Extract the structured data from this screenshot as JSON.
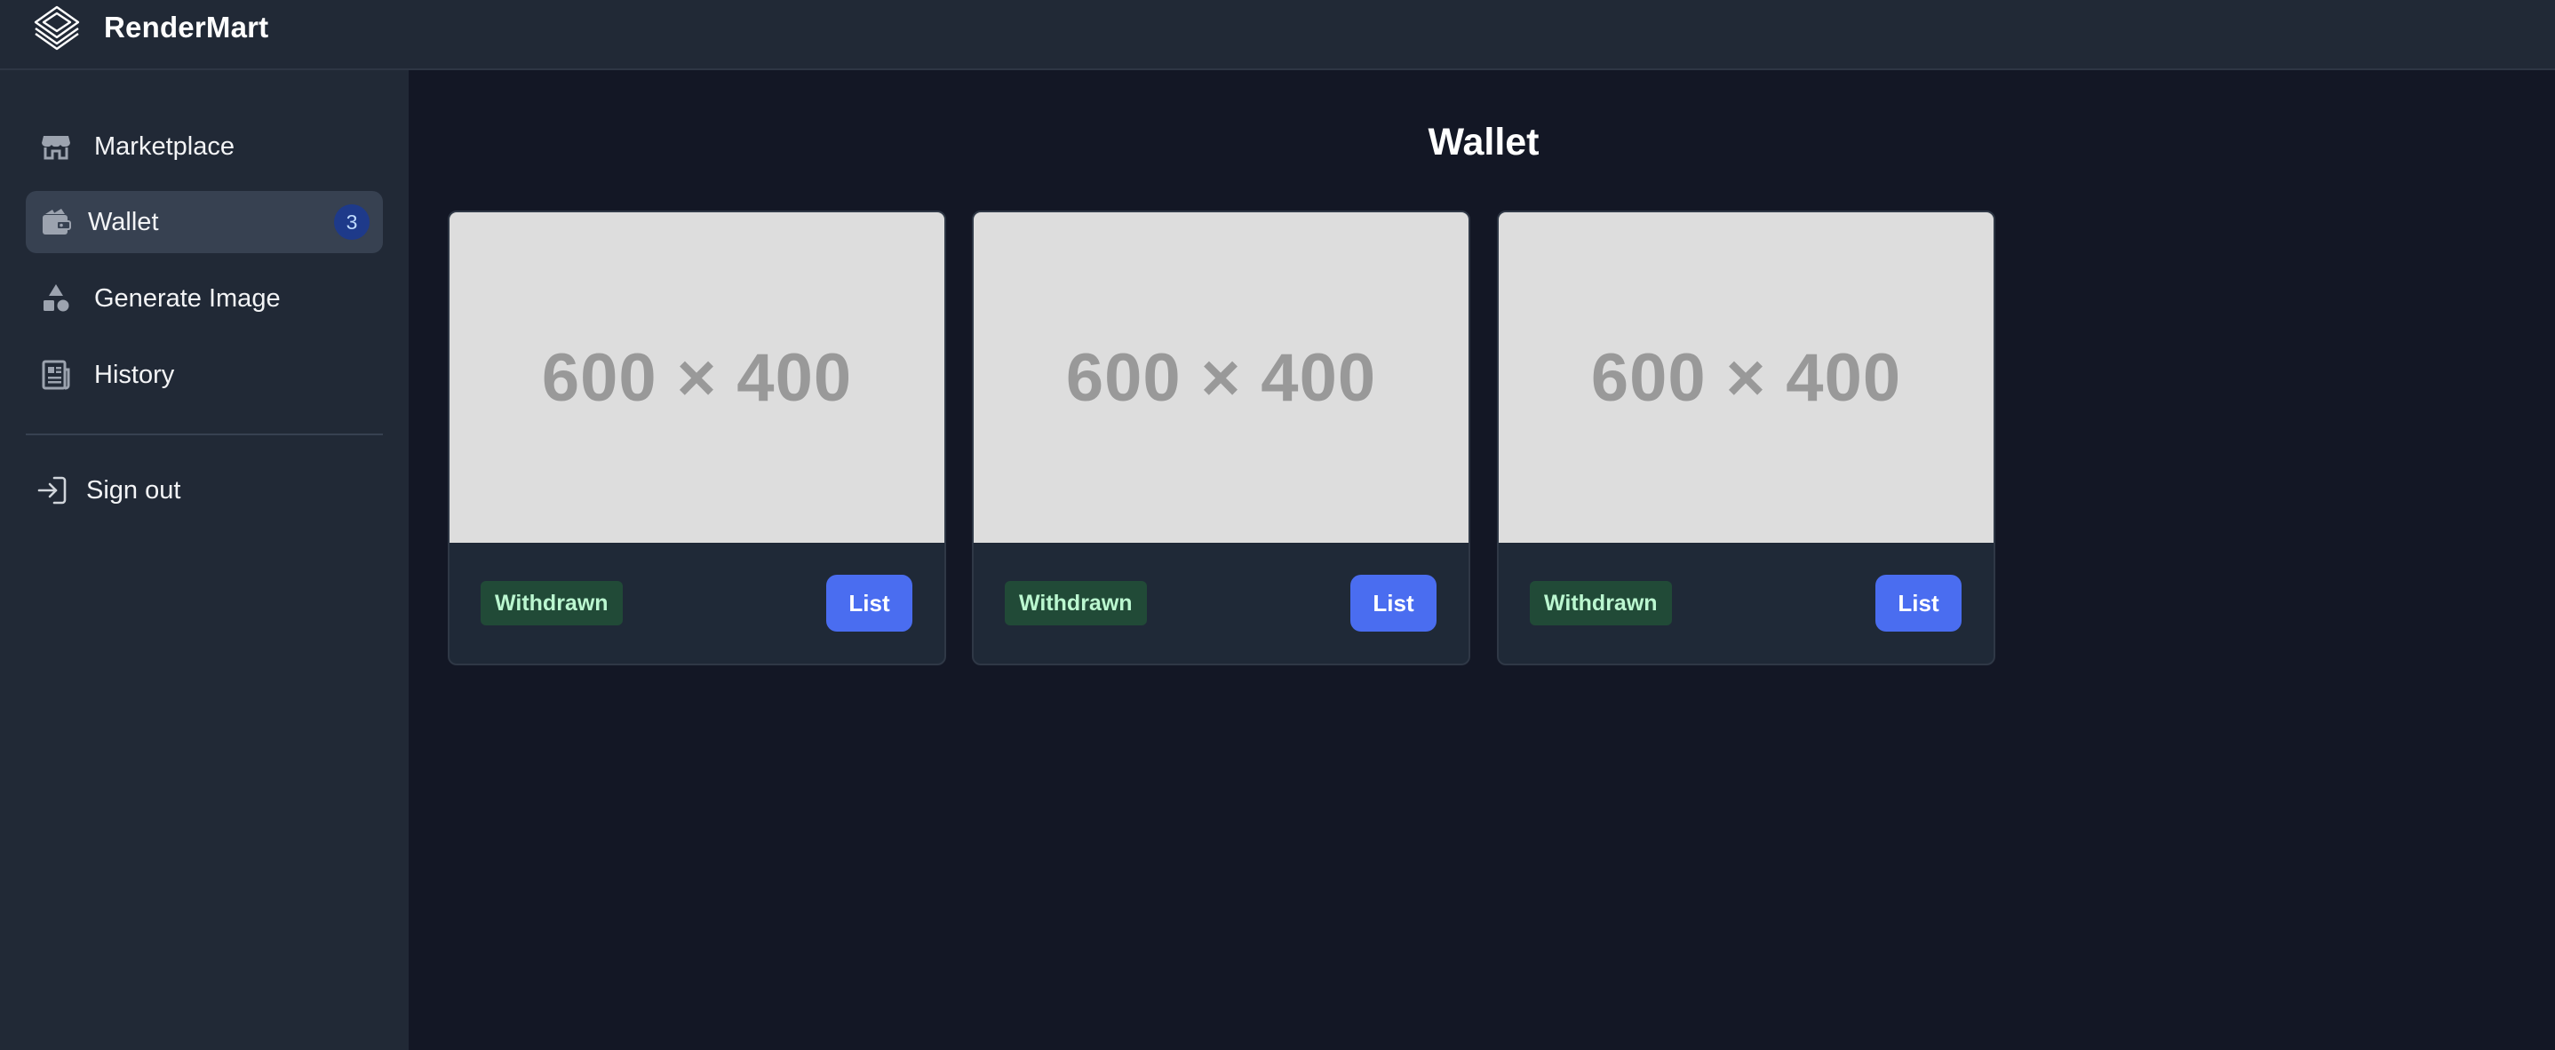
{
  "app": {
    "name": "RenderMart",
    "logo_icon": "layers-logo-icon"
  },
  "sidebar": {
    "items": [
      {
        "label": "Marketplace",
        "icon": "store-icon",
        "active": false
      },
      {
        "label": "Wallet",
        "icon": "wallet-icon",
        "active": true,
        "badge": "3"
      },
      {
        "label": "Generate Image",
        "icon": "shapes-icon",
        "active": false
      },
      {
        "label": "History",
        "icon": "newspaper-icon",
        "active": false
      }
    ],
    "signout": {
      "label": "Sign out",
      "icon": "sign-in-arrow-icon"
    }
  },
  "main": {
    "title": "Wallet",
    "cards": [
      {
        "image_placeholder": "600 × 400",
        "status": "Withdrawn",
        "action_label": "List"
      },
      {
        "image_placeholder": "600 × 400",
        "status": "Withdrawn",
        "action_label": "List"
      },
      {
        "image_placeholder": "600 × 400",
        "status": "Withdrawn",
        "action_label": "List"
      }
    ]
  },
  "colors": {
    "background": "#131725",
    "surface": "#212936",
    "active_item": "#374151",
    "primary_button": "#4a6df0",
    "status_badge_bg": "#214a37",
    "status_badge_text": "#bbf7d0"
  }
}
